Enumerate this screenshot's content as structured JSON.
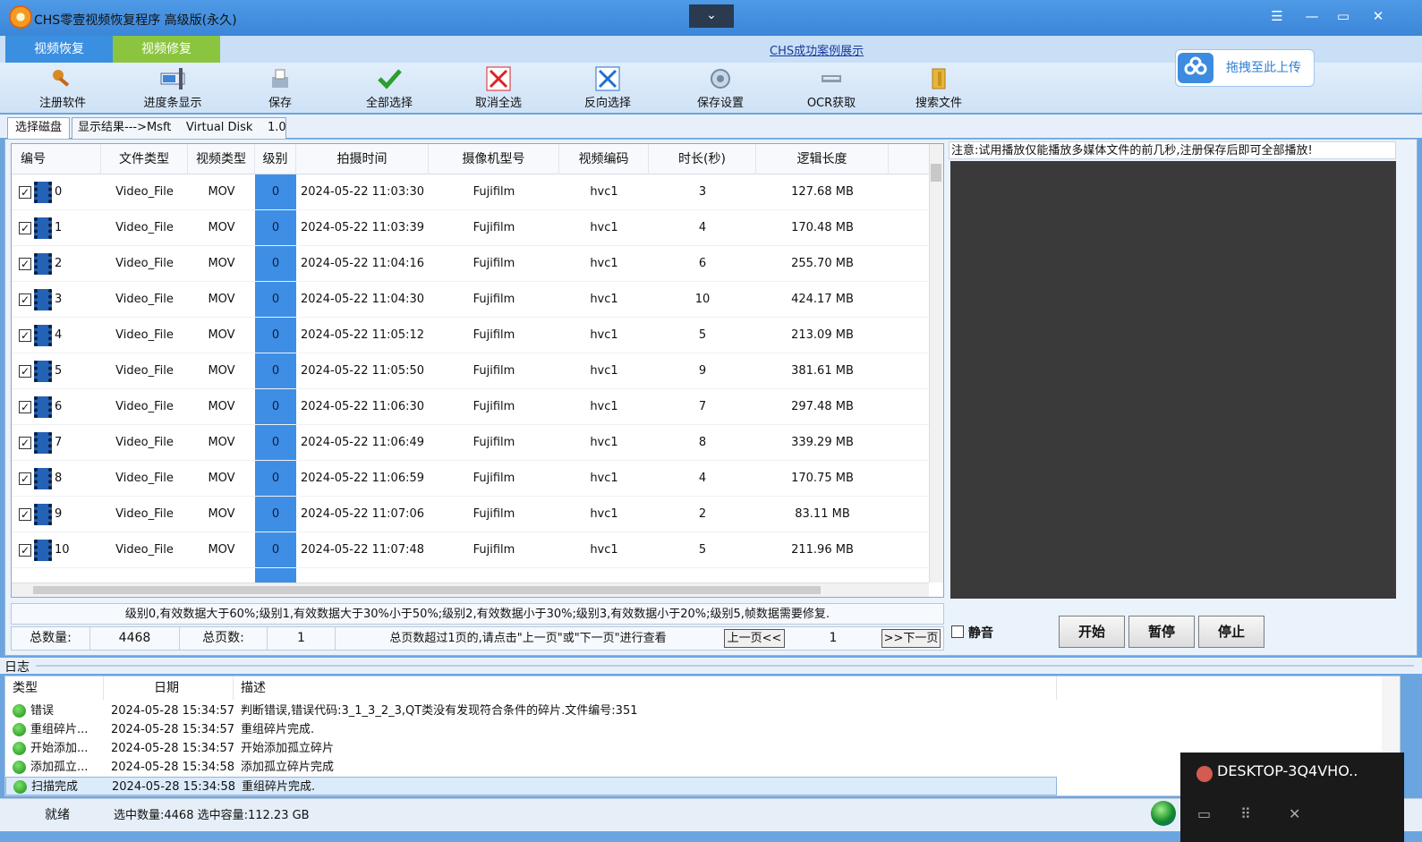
{
  "window": {
    "title": "CHS零壹视频恢复程序 高级版(永久)",
    "collapse_glyph": "⌄",
    "controls": [
      "☰",
      "—",
      "▭",
      "✕"
    ]
  },
  "top_tabs": [
    {
      "label": "视频恢复",
      "color": "#3b8fe0"
    },
    {
      "label": "视频修复",
      "color": "#8bc53f"
    }
  ],
  "case_link": "CHS成功案例展示",
  "toolbar": {
    "items": [
      {
        "label": "注册软件",
        "icon": "key-icon"
      },
      {
        "label": "进度条显示",
        "icon": "progress-icon"
      },
      {
        "label": "保存",
        "icon": "save-icon"
      },
      {
        "label": "全部选择",
        "icon": "check-icon"
      },
      {
        "label": "取消全选",
        "icon": "cancel-icon"
      },
      {
        "label": "反向选择",
        "icon": "invert-icon"
      },
      {
        "label": "保存设置",
        "icon": "settings-icon"
      },
      {
        "label": "OCR获取",
        "icon": "ocr-icon"
      },
      {
        "label": "搜索文件",
        "icon": "folder-icon"
      }
    ]
  },
  "upload": {
    "label": "拖拽至此上传",
    "icon": "cloud-icon"
  },
  "subtabs": {
    "select_disk": "选择磁盘",
    "result": "显示结果--->Msft    Virtual Disk    1.0"
  },
  "table": {
    "columns": [
      "编号",
      "文件类型",
      "视频类型",
      "级别",
      "拍摄时间",
      "摄像机型号",
      "视频编码",
      "时长(秒)",
      "逻辑长度"
    ],
    "rows": [
      [
        "0",
        "Video_File",
        "MOV",
        "0",
        "2024-05-22 11:03:30",
        "Fujifilm",
        "hvc1",
        "3",
        "127.68 MB"
      ],
      [
        "1",
        "Video_File",
        "MOV",
        "0",
        "2024-05-22 11:03:39",
        "Fujifilm",
        "hvc1",
        "4",
        "170.48 MB"
      ],
      [
        "2",
        "Video_File",
        "MOV",
        "0",
        "2024-05-22 11:04:16",
        "Fujifilm",
        "hvc1",
        "6",
        "255.70 MB"
      ],
      [
        "3",
        "Video_File",
        "MOV",
        "0",
        "2024-05-22 11:04:30",
        "Fujifilm",
        "hvc1",
        "10",
        "424.17 MB"
      ],
      [
        "4",
        "Video_File",
        "MOV",
        "0",
        "2024-05-22 11:05:12",
        "Fujifilm",
        "hvc1",
        "5",
        "213.09 MB"
      ],
      [
        "5",
        "Video_File",
        "MOV",
        "0",
        "2024-05-22 11:05:50",
        "Fujifilm",
        "hvc1",
        "9",
        "381.61 MB"
      ],
      [
        "6",
        "Video_File",
        "MOV",
        "0",
        "2024-05-22 11:06:30",
        "Fujifilm",
        "hvc1",
        "7",
        "297.48 MB"
      ],
      [
        "7",
        "Video_File",
        "MOV",
        "0",
        "2024-05-22 11:06:49",
        "Fujifilm",
        "hvc1",
        "8",
        "339.29 MB"
      ],
      [
        "8",
        "Video_File",
        "MOV",
        "0",
        "2024-05-22 11:06:59",
        "Fujifilm",
        "hvc1",
        "4",
        "170.75 MB"
      ],
      [
        "9",
        "Video_File",
        "MOV",
        "0",
        "2024-05-22 11:07:06",
        "Fujifilm",
        "hvc1",
        "2",
        "83.11 MB"
      ],
      [
        "10",
        "Video_File",
        "MOV",
        "0",
        "2024-05-22 11:07:48",
        "Fujifilm",
        "hvc1",
        "5",
        "211.96 MB"
      ]
    ]
  },
  "legend": "级别0,有效数据大于60%;级别1,有效数据大于30%小于50%;级别2,有效数据小于30%;级别3,有效数据小于20%;级别5,帧数据需要修复.",
  "pager": {
    "total_label": "总数量:",
    "total_value": "4468",
    "pages_label": "总页数:",
    "pages_value": "1",
    "hint": "总页数超过1页的,请点击\"上一页\"或\"下一页\"进行查看",
    "prev": "上一页<<",
    "current": "1",
    "next": ">>下一页"
  },
  "preview": {
    "notice": "注意:试用播放仅能播放多媒体文件的前几秒,注册保存后即可全部播放!",
    "mute": "静音",
    "start": "开始",
    "pause": "暂停",
    "stop": "停止"
  },
  "log": {
    "label": "日志",
    "columns": [
      "类型",
      "日期",
      "描述"
    ],
    "rows": [
      [
        "错误",
        "2024-05-28 15:34:57",
        "判断错误,错误代码:3_1_3_2_3,QT类没有发现符合条件的碎片.文件编号:351"
      ],
      [
        "重组碎片...",
        "2024-05-28 15:34:57",
        "重组碎片完成."
      ],
      [
        "开始添加...",
        "2024-05-28 15:34:57",
        "开始添加孤立碎片"
      ],
      [
        "添加孤立...",
        "2024-05-28 15:34:58",
        "添加孤立碎片完成"
      ],
      [
        "扫描完成",
        "2024-05-28 15:34:58",
        "重组碎片完成."
      ]
    ]
  },
  "status": {
    "ready": "就绪",
    "selection": "选中数量:4468 选中容量:112.23 GB"
  },
  "remote": {
    "host": "DESKTOP-3Q4VHO..",
    "icons": [
      "chat-icon",
      "grid-icon",
      "close-icon"
    ]
  }
}
